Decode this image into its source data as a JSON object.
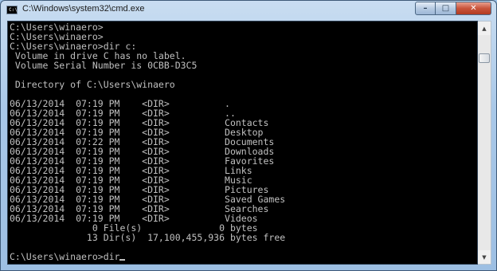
{
  "window": {
    "title": "C:\\Windows\\system32\\cmd.exe",
    "icon_name": "cmd-icon",
    "min_icon": "minimize-icon",
    "max_icon": "maximize-icon",
    "close_icon": "close-icon"
  },
  "console": {
    "lines": [
      "C:\\Users\\winaero>",
      "C:\\Users\\winaero>",
      "C:\\Users\\winaero>dir c:",
      " Volume in drive C has no label.",
      " Volume Serial Number is 0CBB-D3C5",
      "",
      " Directory of C:\\Users\\winaero",
      "",
      "06/13/2014  07:19 PM    <DIR>          .",
      "06/13/2014  07:19 PM    <DIR>          ..",
      "06/13/2014  07:19 PM    <DIR>          Contacts",
      "06/13/2014  07:19 PM    <DIR>          Desktop",
      "06/13/2014  07:22 PM    <DIR>          Documents",
      "06/13/2014  07:19 PM    <DIR>          Downloads",
      "06/13/2014  07:19 PM    <DIR>          Favorites",
      "06/13/2014  07:19 PM    <DIR>          Links",
      "06/13/2014  07:19 PM    <DIR>          Music",
      "06/13/2014  07:19 PM    <DIR>          Pictures",
      "06/13/2014  07:19 PM    <DIR>          Saved Games",
      "06/13/2014  07:19 PM    <DIR>          Searches",
      "06/13/2014  07:19 PM    <DIR>          Videos",
      "               0 File(s)              0 bytes",
      "              13 Dir(s)  17,100,455,936 bytes free",
      "",
      "C:\\Users\\winaero>dir"
    ],
    "text_color": "#c0c0c0",
    "background": "#000000"
  }
}
